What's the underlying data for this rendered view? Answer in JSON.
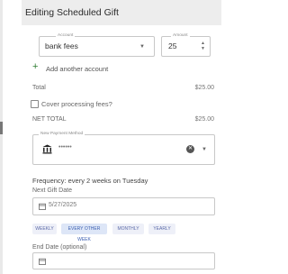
{
  "header": {
    "title": "Editing Scheduled Gift"
  },
  "account": {
    "label": "Account",
    "value": "bank fees"
  },
  "amount": {
    "label": "Amount",
    "value": "25"
  },
  "add_account": {
    "label": "Add another account"
  },
  "total": {
    "label": "Total",
    "value": "$25.00"
  },
  "cover_fees": {
    "label": "Cover processing fees?"
  },
  "net_total": {
    "label": "NET TOTAL",
    "value": "$25.00"
  },
  "payment_method": {
    "label": "New Payment Method",
    "value": "••••••"
  },
  "frequency": {
    "text": "Frequency: every 2 weeks on Tuesday"
  },
  "next_gift": {
    "label": "Next Gift Date",
    "value": "5/27/2025"
  },
  "frequency_options": [
    "WEEKLY",
    "EVERY OTHER WEEK",
    "MONTHLY",
    "YEARLY"
  ],
  "selected_frequency": "EVERY OTHER WEEK",
  "end_date": {
    "label": "End Date (optional)"
  },
  "icons": {
    "add": "plus-icon",
    "bank": "bank-icon",
    "clear": "clear-icon",
    "calendar": "calendar-icon",
    "dropdown": "chevron-down-icon",
    "stepper": "stepper-icon"
  },
  "colors": {
    "header_bg": "#ededed",
    "add_icon": "#2e7d32",
    "chip_text": "#5b6aa8",
    "chip_active_bg": "#dde6f7"
  }
}
